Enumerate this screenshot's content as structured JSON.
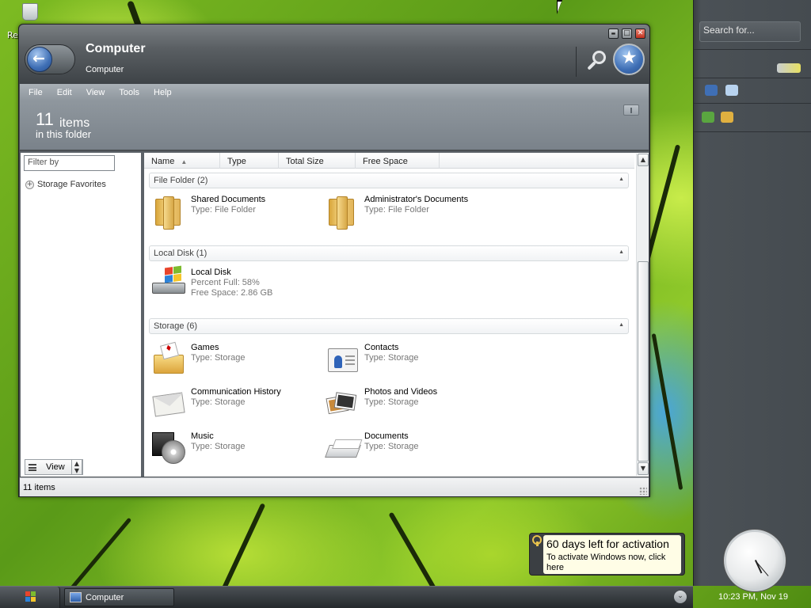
{
  "desktop": {
    "recycle_label": "Re"
  },
  "window": {
    "title": "Computer",
    "subtitle": "Computer",
    "controls": {
      "minimize": "▬",
      "maximize": "□",
      "close": "✕"
    },
    "menu": [
      "File",
      "Edit",
      "View",
      "Tools",
      "Help"
    ],
    "summary": {
      "count": "11",
      "unit": "items",
      "sub": "in this folder"
    },
    "filter_placeholder": "Filter by",
    "storage_favorites": "Storage Favorites",
    "view_button": "View",
    "columns": [
      "Name",
      "Type",
      "Total Size",
      "Free Space"
    ],
    "groups": [
      {
        "header": "File Folder (2)",
        "items": [
          {
            "icon": "folder-icon",
            "name": "Shared Documents",
            "details": [
              "Type: File Folder"
            ]
          },
          {
            "icon": "folder-icon",
            "name": "Administrator's Documents",
            "details": [
              "Type: File Folder"
            ]
          }
        ]
      },
      {
        "header": "Local Disk (1)",
        "items": [
          {
            "icon": "hard-disk-icon",
            "name": "Local Disk",
            "details": [
              "Percent Full: 58%",
              "Free Space: 2.86 GB"
            ]
          }
        ]
      },
      {
        "header": "Storage (6)",
        "items": [
          {
            "icon": "games-icon",
            "name": "Games",
            "details": [
              "Type: Storage"
            ]
          },
          {
            "icon": "contacts-icon",
            "name": "Contacts",
            "details": [
              "Type: Storage"
            ]
          },
          {
            "icon": "envelope-icon",
            "name": "Communication History",
            "details": [
              "Type: Storage"
            ]
          },
          {
            "icon": "photos-icon",
            "name": "Photos and Videos",
            "details": [
              "Type: Storage"
            ]
          },
          {
            "icon": "music-cd-icon",
            "name": "Music",
            "details": [
              "Type: Storage"
            ]
          },
          {
            "icon": "documents-icon",
            "name": "Documents",
            "details": [
              "Type: Storage"
            ]
          }
        ]
      }
    ],
    "status": "11 items"
  },
  "sidebar": {
    "search_placeholder": "Search for...",
    "clock_label": "10:23 PM, Nov 19"
  },
  "activation": {
    "title": "60 days left for activation",
    "text": "To activate Windows now, click here"
  },
  "taskbar": {
    "task": "Computer",
    "chevron": "⌄"
  },
  "colors": {
    "accent_blue": "#3f6fb5",
    "sidebar_bg": "#454b50",
    "balloon_bg": "#fffde6"
  }
}
